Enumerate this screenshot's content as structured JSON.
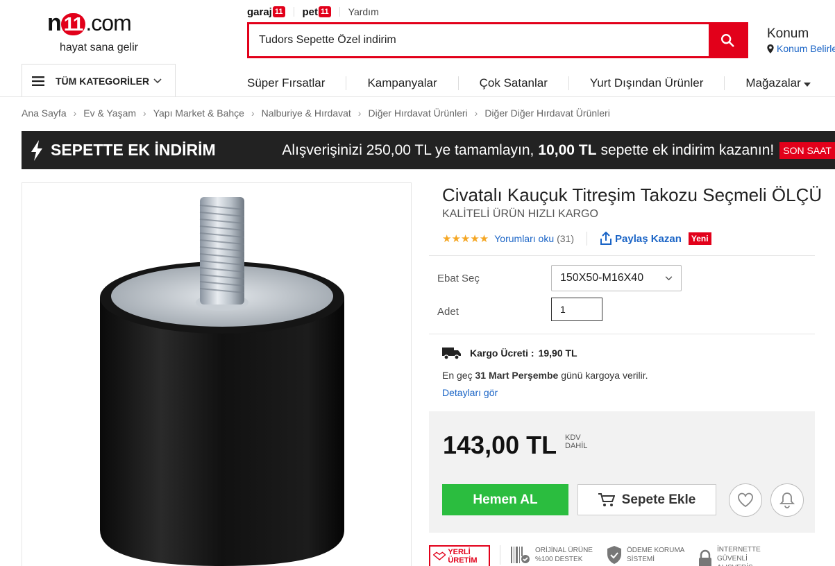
{
  "header": {
    "logo_text": "n11.com",
    "tagline": "hayat sana gelir",
    "sublinks": {
      "garaj": "garaj",
      "garaj_badge": "11",
      "pet": "pet",
      "pet_badge": "11",
      "help": "Yardım"
    },
    "search": {
      "value": "Tudors Sepette Özel indirim"
    },
    "location": {
      "title": "Konum",
      "subtitle": "Konum Belirle"
    },
    "categories_button": "TÜM KATEGORİLER",
    "nav": [
      "Süper Fırsatlar",
      "Kampanyalar",
      "Çok Satanlar",
      "Yurt Dışından Ürünler",
      "Mağazalar"
    ]
  },
  "breadcrumb": [
    "Ana Sayfa",
    "Ev & Yaşam",
    "Yapı Market & Bahçe",
    "Nalburiye & Hırdavat",
    "Diğer Hırdavat Ürünleri",
    "Diğer Diğer Hırdavat Ürünleri"
  ],
  "promo": {
    "title": "SEPETTE EK İNDİRİM",
    "text_before": "Alışverişinizi 250,00 TL ye tamamlayın,",
    "amount": "10,00 TL",
    "text_after": "sepette ek indirim kazanın!",
    "badge": "SON SAAT"
  },
  "product": {
    "title": "Civatalı Kauçuk Titreşim Takozu Seçmeli ÖLÇÜ",
    "subtitle": "KALİTELİ ÜRÜN HIZLI KARGO",
    "stars": "★★★★★",
    "rating": 5,
    "reviews_link": "Yorumları oku",
    "review_count": "(31)",
    "share": "Paylaş Kazan",
    "new_badge": "Yeni",
    "size_label": "Ebat Seç",
    "size_value": "150X50-M16X40",
    "qty_label": "Adet",
    "qty_value": "1",
    "cargo_label": "Kargo Ücreti :",
    "cargo_value": "19,90 TL",
    "ship_prefix": "En geç",
    "ship_date": "31 Mart Perşembe",
    "ship_suffix": "günü kargoya verilir.",
    "details_link": "Detayları gör",
    "price": "143,00 TL",
    "kdv": "KDV DAHİL",
    "buy_now": "Hemen AL",
    "add_to_cart": "Sepete Ekle"
  },
  "trust": {
    "local": "YERLİ ÜRETİM",
    "original": "ORİJİNAL ÜRÜNE %100 DESTEK",
    "payment": "ÖDEME KORUMA SİSTEMİ",
    "secure": "İNTERNETTE GÜVENLİ ALIŞVERİŞ"
  },
  "colors": {
    "brand_red": "#e2001a",
    "buy_green": "#2bbd3f",
    "link_blue": "#1a64c6",
    "promo_bg": "#222222"
  },
  "icons": [
    "menu-icon",
    "chevron-down-icon",
    "search-icon",
    "location-pin-icon",
    "bolt-icon",
    "share-icon",
    "truck-icon",
    "cart-icon",
    "heart-icon",
    "bell-icon"
  ]
}
